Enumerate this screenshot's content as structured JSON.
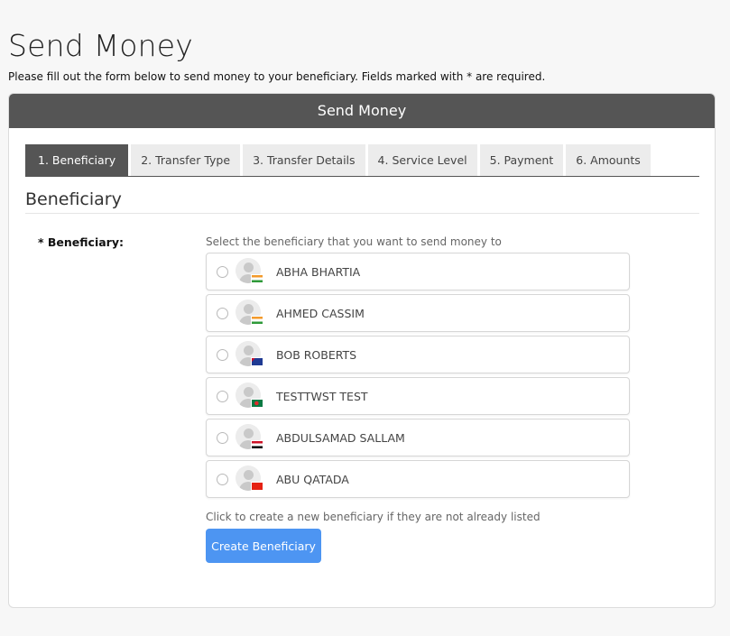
{
  "page": {
    "title": "Send Money",
    "intro": "Please fill out the form below to send money to your beneficiary. Fields marked with * are required."
  },
  "panel": {
    "header": "Send Money",
    "tabs": [
      {
        "label": "1. Beneficiary",
        "active": true
      },
      {
        "label": "2. Transfer Type",
        "active": false
      },
      {
        "label": "3. Transfer Details",
        "active": false
      },
      {
        "label": "4. Service Level",
        "active": false
      },
      {
        "label": "5. Payment",
        "active": false
      },
      {
        "label": "6. Amounts",
        "active": false
      }
    ],
    "section_title": "Beneficiary"
  },
  "form": {
    "field_label": "* Beneficiary:",
    "hint": "Select the beneficiary that you want to send money to",
    "beneficiaries": [
      {
        "name": "ABHA BHARTIA",
        "flag_icon": "india-flag-icon",
        "selected": false
      },
      {
        "name": "AHMED CASSIM",
        "flag_icon": "india-flag-icon",
        "selected": false
      },
      {
        "name": "BOB ROBERTS",
        "flag_icon": "australia-flag-icon",
        "selected": false
      },
      {
        "name": "TESTTWST TEST",
        "flag_icon": "bangladesh-flag-icon",
        "selected": false
      },
      {
        "name": "ABDULSAMAD SALLAM",
        "flag_icon": "yemen-flag-icon",
        "selected": false
      },
      {
        "name": "ABU QATADA",
        "flag_icon": "china-flag-icon",
        "selected": false
      }
    ],
    "create_hint": "Click to create a new beneficiary if they are not already listed",
    "create_button": "Create Beneficiary"
  },
  "colors": {
    "header_bg": "#555555",
    "button_blue": "#4d95f2",
    "tab_inactive_bg": "#ececec"
  }
}
